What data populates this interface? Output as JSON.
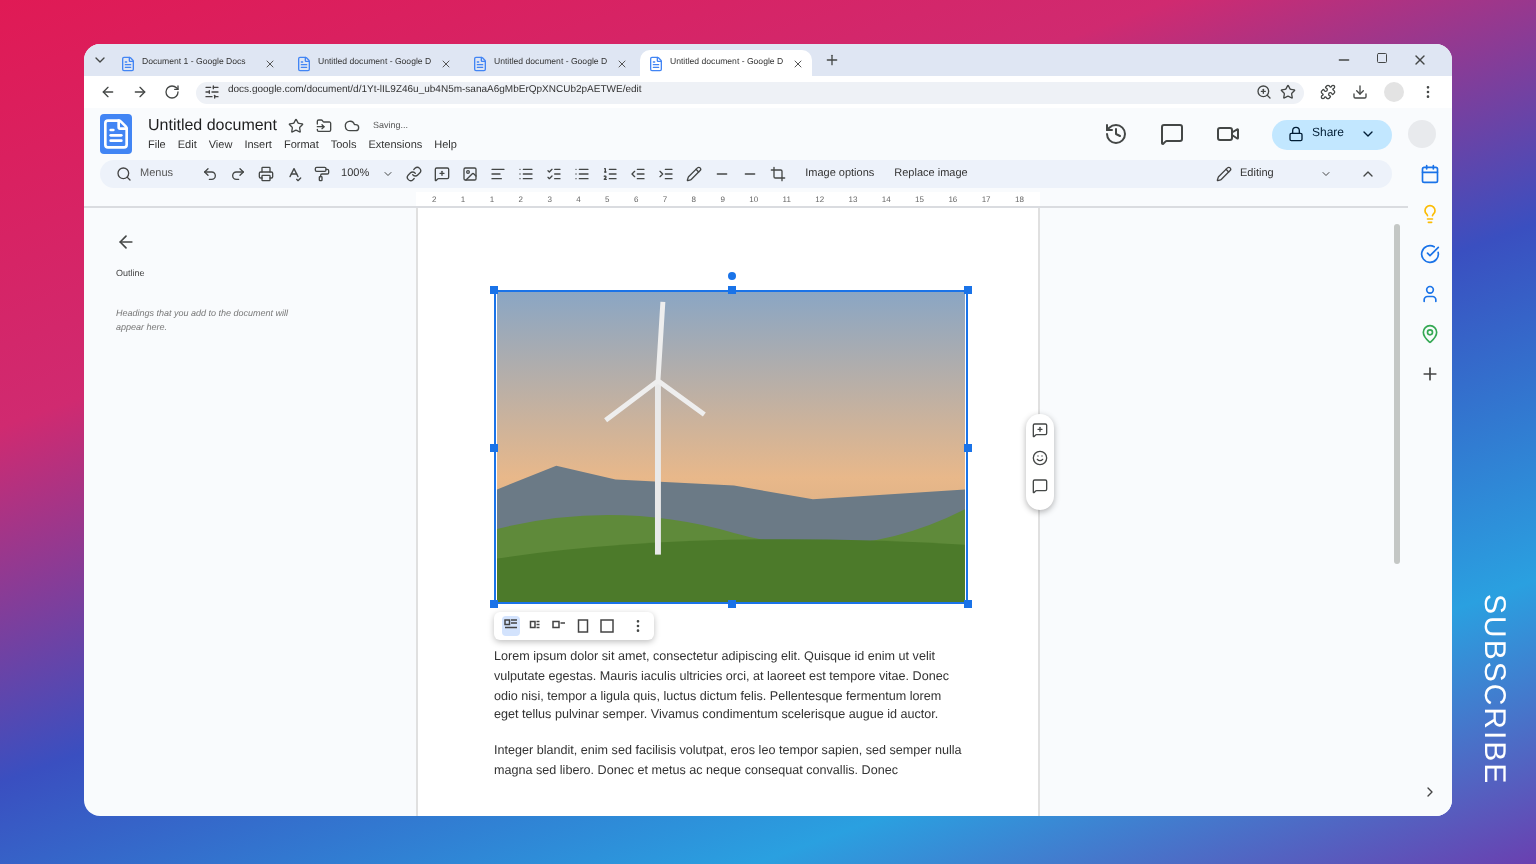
{
  "browser": {
    "tabs": [
      {
        "title": "Document 1 - Google Docs",
        "selected": false
      },
      {
        "title": "Untitled document - Google D",
        "selected": false
      },
      {
        "title": "Untitled document - Google D",
        "selected": false
      },
      {
        "title": "Untitled document - Google D",
        "selected": true
      }
    ],
    "url": "docs.google.com/document/d/1Yt-lIL9Z46u_ub4N5m-sanaA6gMbErQpXNCUb2pAETWE/edit"
  },
  "docs": {
    "title": "Untitled document",
    "save_status": "Saving...",
    "menu": [
      "File",
      "Edit",
      "View",
      "Insert",
      "Format",
      "Tools",
      "Extensions",
      "Help"
    ],
    "share_label": "Share",
    "toolbar": {
      "search_placeholder": "Menus",
      "zoom": "100%",
      "image_options": "Image options",
      "replace_image": "Replace image",
      "mode": "Editing"
    },
    "ruler": [
      "2",
      "1",
      "1",
      "2",
      "3",
      "4",
      "5",
      "6",
      "7",
      "8",
      "9",
      "10",
      "11",
      "12",
      "13",
      "14",
      "15",
      "16",
      "17",
      "18"
    ],
    "outline": {
      "title": "Outline",
      "empty_hint": "Headings that you add to the document will appear here."
    },
    "wrap_options": [
      {
        "selected": true
      },
      {
        "selected": false
      },
      {
        "selected": false
      },
      {
        "selected": false
      },
      {
        "selected": false
      }
    ],
    "paragraphs": [
      "Lorem ipsum dolor sit amet, consectetur adipiscing elit. Quisque id enim ut velit vulputate egestas. Mauris iaculis ultricies orci, at laoreet est tempore vitae. Donec odio nisi, tempor a ligula quis, luctus dictum felis. Pellentesque fermentum lorem eget tellus pulvinar semper. Vivamus condimentum scelerisque augue id auctor.",
      "Integer blandit, enim sed facilisis volutpat, eros leo tempor sapien, sed semper nulla magna sed libero. Donec et metus ac neque consequat convallis. Donec"
    ]
  },
  "overlay_text": "SUBSCRIBE"
}
